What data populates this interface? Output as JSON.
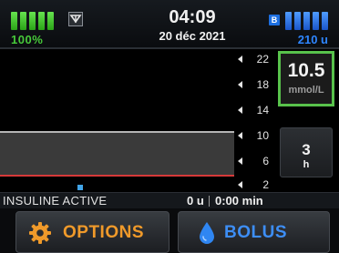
{
  "status": {
    "battery_text": "100%",
    "time": "04:09",
    "date": "20 déc 2021",
    "bluetooth_label": "B",
    "reservoir_text": "210 u"
  },
  "graph": {
    "y_ticks": [
      "22",
      "18",
      "14",
      "10",
      "6",
      "2"
    ]
  },
  "glucose": {
    "value": "10.5",
    "unit": "mmol/L"
  },
  "timespan": {
    "value": "3",
    "unit": "h"
  },
  "iob": {
    "label": "INSULINE ACTIVE",
    "units": "0 u",
    "time": "0:00 min"
  },
  "buttons": {
    "options_label": "OPTIONS",
    "bolus_label": "BOLUS"
  },
  "colors": {
    "battery": "#47c93a",
    "reservoir": "#2e86ff",
    "glucose_border": "#58c24b",
    "options": "#f09a2a",
    "bolus": "#3d8ef5",
    "target_high": "#b5b5b5",
    "target_low": "#d63a3a"
  }
}
